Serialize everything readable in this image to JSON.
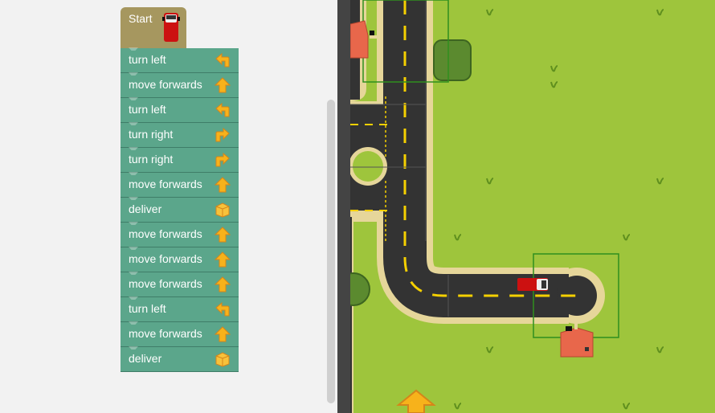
{
  "program": {
    "start_label": "Start",
    "blocks": [
      {
        "label": "turn left",
        "icon": "turn-left-arrow-icon"
      },
      {
        "label": "move forwards",
        "icon": "forward-arrow-icon"
      },
      {
        "label": "turn left",
        "icon": "turn-left-arrow-icon"
      },
      {
        "label": "turn right",
        "icon": "turn-right-arrow-icon"
      },
      {
        "label": "turn right",
        "icon": "turn-right-arrow-icon"
      },
      {
        "label": "move forwards",
        "icon": "forward-arrow-icon"
      },
      {
        "label": "deliver",
        "icon": "package-box-icon"
      },
      {
        "label": "move forwards",
        "icon": "forward-arrow-icon"
      },
      {
        "label": "move forwards",
        "icon": "forward-arrow-icon"
      },
      {
        "label": "move forwards",
        "icon": "forward-arrow-icon"
      },
      {
        "label": "turn left",
        "icon": "turn-left-arrow-icon"
      },
      {
        "label": "move forwards",
        "icon": "forward-arrow-icon"
      },
      {
        "label": "deliver",
        "icon": "package-box-icon"
      }
    ]
  },
  "colors": {
    "block": "#5ba68b",
    "start_block": "#a6975f",
    "grass": "#9ec53c",
    "road": "#333333",
    "road_line": "#f5d000",
    "van": "#cc1111",
    "house": "#e8674b",
    "arrow": "#f7b21b"
  }
}
